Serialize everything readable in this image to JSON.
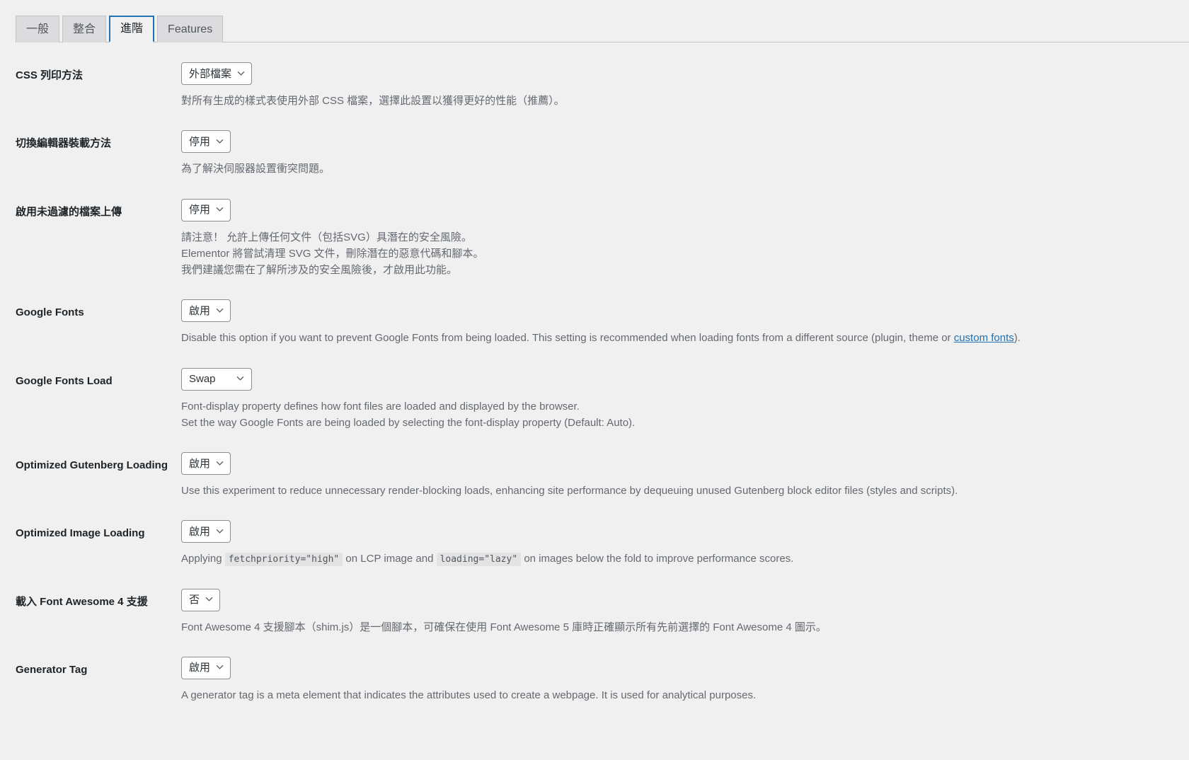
{
  "tabs": [
    {
      "label": "一般",
      "active": false
    },
    {
      "label": "整合",
      "active": false
    },
    {
      "label": "進階",
      "active": true
    },
    {
      "label": "Features",
      "active": false
    }
  ],
  "settings": [
    {
      "label": "CSS 列印方法",
      "value": "外部檔案",
      "select_width": "auto",
      "desc": [
        "對所有生成的樣式表使用外部 CSS 檔案，選擇此設置以獲得更好的性能（推薦）。"
      ]
    },
    {
      "label": "切換編輯器裝載方法",
      "value": "停用",
      "select_width": "auto",
      "desc": [
        "為了解決伺服器設置衝突問題。"
      ]
    },
    {
      "label": "啟用未過濾的檔案上傳",
      "value": "停用",
      "select_width": "auto",
      "desc": [
        "請注意！ 允許上傳任何文件（包括SVG）具潛在的安全風險。",
        "Elementor 將嘗試清理 SVG 文件，刪除潛在的惡意代碼和腳本。",
        "我們建議您需在了解所涉及的安全風險後，才啟用此功能。"
      ]
    },
    {
      "label": "Google Fonts",
      "value": "啟用",
      "select_width": "auto",
      "desc_rich": {
        "before": "Disable this option if you want to prevent Google Fonts from being loaded. This setting is recommended when loading fonts from a different source (plugin, theme or ",
        "link": "custom fonts",
        "after": ")."
      }
    },
    {
      "label": "Google Fonts Load",
      "value": "Swap",
      "select_width": "wide",
      "desc": [
        "Font-display property defines how font files are loaded and displayed by the browser.",
        "Set the way Google Fonts are being loaded by selecting the font-display property (Default: Auto)."
      ]
    },
    {
      "label": "Optimized Gutenberg Loading",
      "value": "啟用",
      "select_width": "auto",
      "desc": [
        "Use this experiment to reduce unnecessary render-blocking loads, enhancing site performance by dequeuing unused Gutenberg block editor files (styles and scripts)."
      ]
    },
    {
      "label": "Optimized Image Loading",
      "value": "啟用",
      "select_width": "auto",
      "desc_code": {
        "part1": "Applying ",
        "code1": "fetchpriority=\"high\"",
        "part2": " on LCP image and ",
        "code2": "loading=\"lazy\"",
        "part3": " on images below the fold to improve performance scores."
      }
    },
    {
      "label": "載入 Font Awesome 4 支援",
      "value": "否",
      "select_width": "auto",
      "desc": [
        "Font Awesome 4 支援腳本（shim.js）是一個腳本，可確保在使用 Font Awesome 5 庫時正確顯示所有先前選擇的 Font Awesome 4 圖示。"
      ]
    },
    {
      "label": "Generator Tag",
      "value": "啟用",
      "select_width": "auto",
      "desc": [
        "A generator tag is a meta element that indicates the attributes used to create a webpage. It is used for analytical purposes."
      ]
    }
  ],
  "colors": {
    "page_bg": "#f0f0f1",
    "accent": "#2271b1",
    "label": "#1d2327",
    "desc": "#646970",
    "tab_inactive_bg": "#dcdcde"
  }
}
